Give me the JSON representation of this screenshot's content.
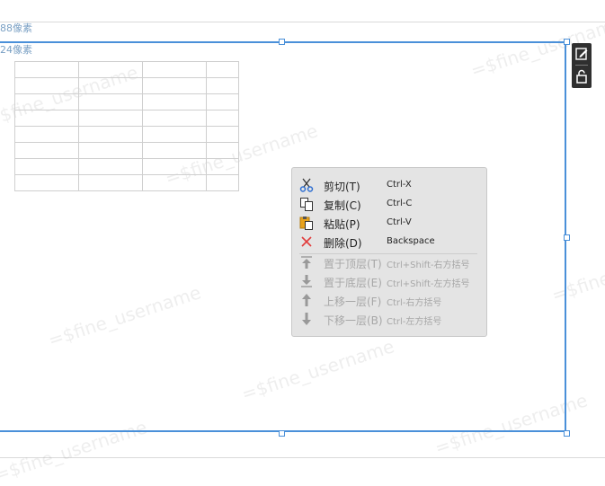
{
  "ruler": {
    "label_top": "88像素",
    "label_second": "24像素"
  },
  "watermark": "=$fine_username",
  "context_menu": {
    "items": [
      {
        "label": "剪切(T)",
        "shortcut": "Ctrl-X",
        "icon": "scissors-icon",
        "enabled": true
      },
      {
        "label": "复制(C)",
        "shortcut": "Ctrl-C",
        "icon": "copy-icon",
        "enabled": true
      },
      {
        "label": "粘贴(P)",
        "shortcut": "Ctrl-V",
        "icon": "paste-icon",
        "enabled": true
      },
      {
        "label": "删除(D)",
        "shortcut": "Backspace",
        "icon": "delete-icon",
        "enabled": true
      },
      {
        "label": "置于顶层(T)",
        "shortcut": "Ctrl+Shift-右方括号",
        "icon": "bring-to-top-icon",
        "enabled": false
      },
      {
        "label": "置于底层(E)",
        "shortcut": "Ctrl+Shift-左方括号",
        "icon": "send-to-bottom-icon",
        "enabled": false
      },
      {
        "label": "上移一层(F)",
        "shortcut": "Ctrl-右方括号",
        "icon": "move-up-icon",
        "enabled": false
      },
      {
        "label": "下移一层(B)",
        "shortcut": "Ctrl-左方括号",
        "icon": "move-down-icon",
        "enabled": false
      }
    ]
  },
  "toolbar": {
    "edit_icon": "edit-icon",
    "lock_icon": "unlock-icon"
  },
  "colors": {
    "selection": "#4a90d9",
    "menu_bg": "#e4e4e4",
    "delete_red": "#e23b3b",
    "paste_orange": "#e8a21c"
  }
}
